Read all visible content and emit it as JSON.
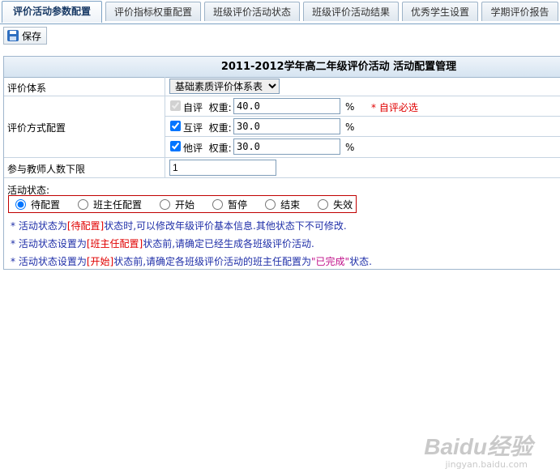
{
  "tabs": [
    {
      "label": "评价活动参数配置",
      "active": true
    },
    {
      "label": "评价指标权重配置",
      "active": false
    },
    {
      "label": "班级评价活动状态",
      "active": false
    },
    {
      "label": "班级评价活动结果",
      "active": false
    },
    {
      "label": "优秀学生设置",
      "active": false
    },
    {
      "label": "学期评价报告",
      "active": false
    }
  ],
  "toolbar": {
    "save_label": "保存",
    "save_icon": "save-icon"
  },
  "panel": {
    "title": "2011-2012学年高二年级评价活动 活动配置管理",
    "system": {
      "label": "评价体系",
      "selected": "基础素质评价体系表"
    },
    "method": {
      "label": "评价方式配置",
      "items": [
        {
          "name": "自评",
          "weight_label": "权重:",
          "value": "40.0",
          "unit": "%",
          "checked": true,
          "disabled": true,
          "note": "* 自评必选"
        },
        {
          "name": "互评",
          "weight_label": "权重:",
          "value": "30.0",
          "unit": "%",
          "checked": true,
          "disabled": false
        },
        {
          "name": "他评",
          "weight_label": "权重:",
          "value": "30.0",
          "unit": "%",
          "checked": true,
          "disabled": false
        }
      ]
    },
    "min_teachers": {
      "label": "参与教师人数下限",
      "value": "1"
    },
    "status": {
      "label": "活动状态:",
      "options": [
        "待配置",
        "班主任配置",
        "开始",
        "暂停",
        "结束",
        "失效"
      ],
      "selected": "待配置"
    },
    "notes": [
      {
        "pre": "* 活动状态为",
        "hl": "[待配置]",
        "post": "状态时,可以修改年级评价基本信息.其他状态下不可修改."
      },
      {
        "pre": "* 活动状态设置为",
        "hl": "[班主任配置]",
        "post": "状态前,请确定已经生成各班级评价活动."
      },
      {
        "pre": "* 活动状态设置为",
        "hl": "[开始]",
        "mid": "状态前,请确定各班级评价活动的班主任配置为",
        "hl2": "\"已完成\"",
        "post": "状态."
      }
    ]
  },
  "watermark": {
    "main": "Baidu经验",
    "sub": "jingyan.baidu.com"
  },
  "colors": {
    "accent": "#1f2fa8",
    "required": "#e00000",
    "highlight": "#c0108a"
  }
}
